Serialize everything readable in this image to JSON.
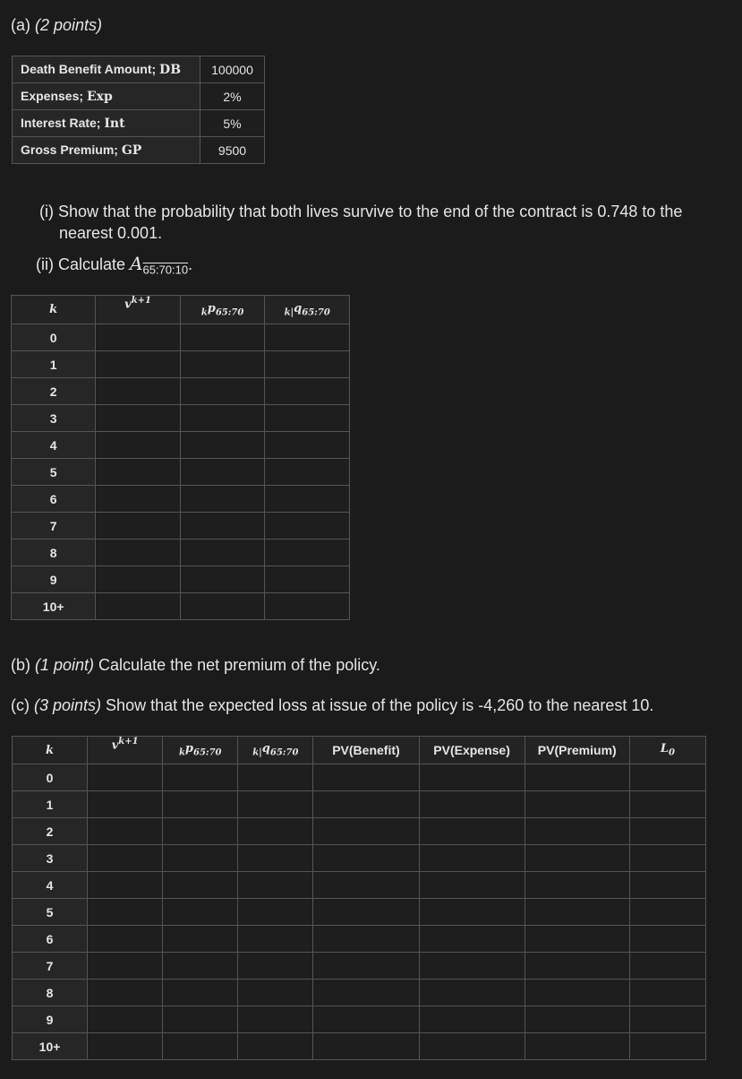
{
  "part_a": {
    "label": "(a)",
    "points": "(2 points)"
  },
  "params": [
    {
      "label": "Death Benefit Amount; ",
      "symbol": "DB",
      "value": "100000"
    },
    {
      "label": "Expenses; ",
      "symbol": "Exp",
      "value": "2%"
    },
    {
      "label": "Interest Rate; ",
      "symbol": "Int",
      "value": "5%"
    },
    {
      "label": "Gross Premium; ",
      "symbol": "GP",
      "value": "9500"
    }
  ],
  "questions": {
    "i": "(i) Show that the probability that both lives survive to the end of the contract is 0.748 to the nearest 0.001.",
    "ii_prefix": "(ii) Calculate ",
    "ii_symbol": "A",
    "ii_subscript": "65:70:10",
    "ii_suffix": "."
  },
  "table1": {
    "headers": [
      "k",
      "v",
      "k+1",
      "k",
      "p",
      "65:70",
      "k|",
      "q",
      "65:70"
    ],
    "k_values": [
      "0",
      "1",
      "2",
      "3",
      "4",
      "5",
      "6",
      "7",
      "8",
      "9",
      "10+"
    ]
  },
  "part_b": {
    "label": "(b) ",
    "points": "(1 point)",
    "text": " Calculate the net premium of the policy."
  },
  "part_c": {
    "label": "(c) ",
    "points": "(3 points)",
    "text": " Show that the expected loss at issue of the policy is -4,260 to the nearest 10."
  },
  "table2": {
    "headers": [
      "k",
      "PV(Benefit)",
      "PV(Expense)",
      "PV(Premium)",
      "L",
      "0"
    ],
    "k_values": [
      "0",
      "1",
      "2",
      "3",
      "4",
      "5",
      "6",
      "7",
      "8",
      "9",
      "10+"
    ]
  }
}
